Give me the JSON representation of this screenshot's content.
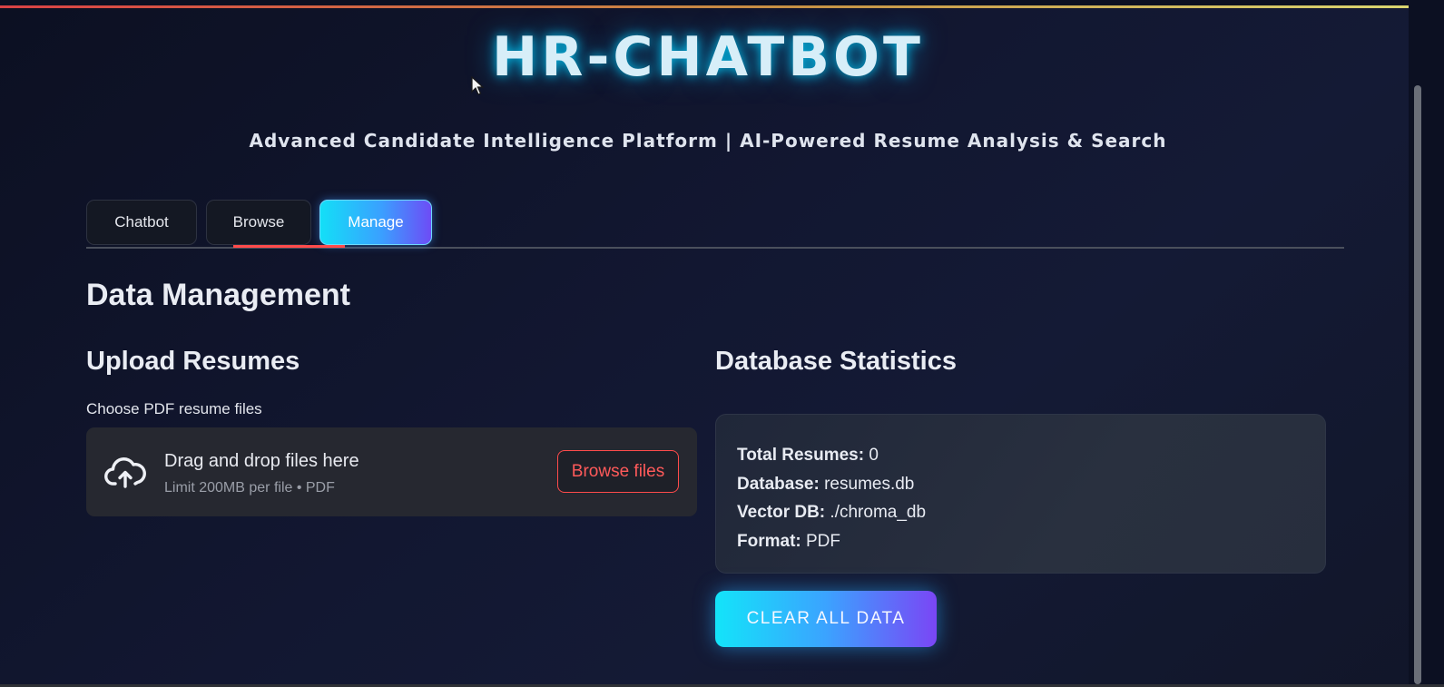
{
  "app": {
    "title": "HR-CHATBOT",
    "subtitle": "Advanced Candidate Intelligence Platform | AI-Powered Resume Analysis & Search"
  },
  "tabs": [
    {
      "label": "Chatbot",
      "active": false
    },
    {
      "label": "Browse",
      "active": false
    },
    {
      "label": "Manage",
      "active": true
    }
  ],
  "main": {
    "page_title": "Data Management",
    "upload": {
      "title": "Upload Resumes",
      "label": "Choose PDF resume files",
      "drop_text": "Drag and drop files here",
      "limit_text": "Limit 200MB per file • PDF",
      "browse_label": "Browse files",
      "icon": "cloud-upload-icon"
    },
    "stats": {
      "title": "Database Statistics",
      "rows": [
        {
          "key": "Total Resumes:",
          "value": " 0"
        },
        {
          "key": "Database:",
          "value": " resumes.db"
        },
        {
          "key": "Vector DB:",
          "value": " ./chroma_db"
        },
        {
          "key": "Format:",
          "value": " PDF"
        }
      ]
    },
    "clear_label": "CLEAR ALL DATA"
  },
  "colors": {
    "accent_cyan": "#13dff7",
    "accent_violet": "#6d4cf6",
    "streamlit_red": "#ff4b4b",
    "background": "#0c1022"
  }
}
